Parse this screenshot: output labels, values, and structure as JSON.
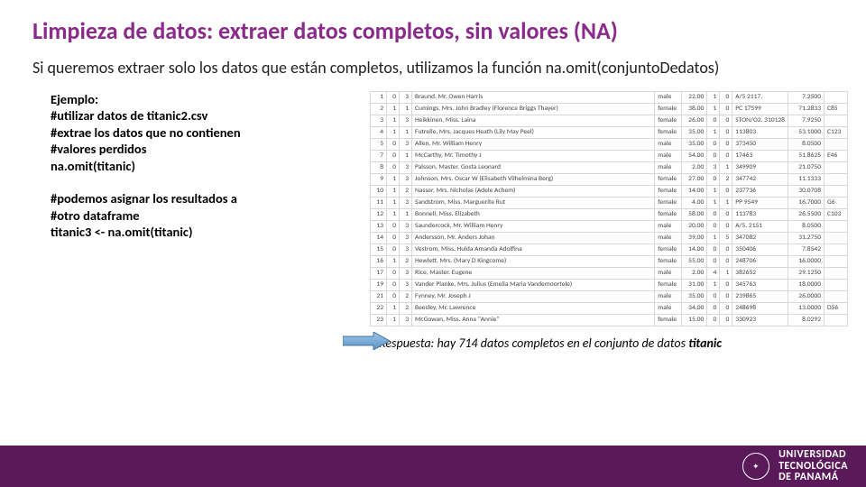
{
  "title": "Limpieza de datos: extraer datos completos, sin valores (NA)",
  "intro": "Si queremos extraer solo los datos que están completos, utilizamos la función na.omit(conjuntoDedatos)",
  "example": {
    "heading": "Ejemplo:",
    "l1": "#utilizar datos de  titanic2.csv",
    "l2": "#extrae los datos que no contienen",
    "l3": "#valores perdidos",
    "l4": "na.omit(titanic)",
    "l5": "#podemos asignar los resultados a",
    "l6": "#otro dataframe",
    "l7": "titanic3 <- na.omit(titanic)"
  },
  "answer": {
    "prefix": "Respuesta: hay 714 datos completos en el conjunto de datos ",
    "bold": "titanic"
  },
  "footer": {
    "uni1": "UNIVERSIDAD",
    "uni2": "TECNOLÓGICA",
    "uni3": "DE PANAMÁ"
  },
  "table": {
    "rows": [
      [
        "1",
        "0",
        "3",
        "Braund, Mr. Owen Harris",
        "male",
        "22.00",
        "1",
        "0",
        "A/5 2117.",
        "7.2500",
        ""
      ],
      [
        "2",
        "1",
        "1",
        "Cumings, Mrs. John Bradley (Florence Briggs Thayer)",
        "female",
        "38.00",
        "1",
        "0",
        "PC 17599",
        "71.2833",
        "C85"
      ],
      [
        "3",
        "1",
        "3",
        "Heikkinen, Miss. Laina",
        "female",
        "26.00",
        "0",
        "0",
        "STON/O2. 310128",
        "7.9250",
        ""
      ],
      [
        "4",
        "1",
        "1",
        "Futrelle, Mrs. Jacques Heath (Lily May Peel)",
        "female",
        "35.00",
        "1",
        "0",
        "113803",
        "53.1000",
        "C123"
      ],
      [
        "5",
        "0",
        "3",
        "Allen, Mr. William Henry",
        "male",
        "35.00",
        "0",
        "0",
        "373450",
        "8.0500",
        ""
      ],
      [
        "7",
        "0",
        "1",
        "McCarthy, Mr. Timothy J",
        "male",
        "54.00",
        "0",
        "0",
        "17463",
        "51.8625",
        "E46"
      ],
      [
        "8",
        "0",
        "3",
        "Palsson, Master. Gosta Leonard",
        "male",
        "2.00",
        "3",
        "1",
        "349909",
        "21.0750",
        ""
      ],
      [
        "9",
        "1",
        "3",
        "Johnson, Mrs. Oscar W (Elisabeth Vilhelmina Berg)",
        "female",
        "27.00",
        "0",
        "2",
        "347742",
        "11.1333",
        ""
      ],
      [
        "10",
        "1",
        "2",
        "Nasser, Mrs. Nicholas (Adele Achem)",
        "female",
        "14.00",
        "1",
        "0",
        "237736",
        "30.0708",
        ""
      ],
      [
        "11",
        "1",
        "3",
        "Sandstrom, Miss. Marguerite Rut",
        "female",
        "4.00",
        "1",
        "1",
        "PP 9549",
        "16.7000",
        "G6"
      ],
      [
        "12",
        "1",
        "1",
        "Bonnell, Miss. Elizabeth",
        "female",
        "58.00",
        "0",
        "0",
        "113783",
        "26.5500",
        "C103"
      ],
      [
        "13",
        "0",
        "3",
        "Saundercock, Mr. William Henry",
        "male",
        "20.00",
        "0",
        "0",
        "A/5. 2151",
        "8.0500",
        ""
      ],
      [
        "14",
        "0",
        "3",
        "Andersson, Mr. Anders Johan",
        "male",
        "39.00",
        "1",
        "5",
        "347082",
        "31.2750",
        ""
      ],
      [
        "15",
        "0",
        "3",
        "Vestrom, Miss. Hulda Amanda Adolfina",
        "female",
        "14.00",
        "0",
        "0",
        "350406",
        "7.8542",
        ""
      ],
      [
        "16",
        "1",
        "2",
        "Hewlett, Mrs. (Mary D Kingcome)",
        "female",
        "55.00",
        "0",
        "0",
        "248706",
        "16.0000",
        ""
      ],
      [
        "17",
        "0",
        "3",
        "Rice, Master. Eugene",
        "male",
        "2.00",
        "4",
        "1",
        "382652",
        "29.1250",
        ""
      ],
      [
        "19",
        "0",
        "3",
        "Vander Planke, Mrs. Julius (Emelia Maria Vandemoortele)",
        "female",
        "31.00",
        "1",
        "0",
        "345763",
        "18.0000",
        ""
      ],
      [
        "21",
        "0",
        "2",
        "Fynney, Mr. Joseph J",
        "male",
        "35.00",
        "0",
        "0",
        "239865",
        "26.0000",
        ""
      ],
      [
        "22",
        "1",
        "2",
        "Beesley, Mr. Lawrence",
        "male",
        "34.00",
        "0",
        "0",
        "248698",
        "13.0000",
        "D56"
      ],
      [
        "23",
        "1",
        "3",
        "McGowan, Miss. Anna \"Annie\"",
        "female",
        "15.00",
        "0",
        "0",
        "330923",
        "8.0292",
        ""
      ]
    ]
  }
}
